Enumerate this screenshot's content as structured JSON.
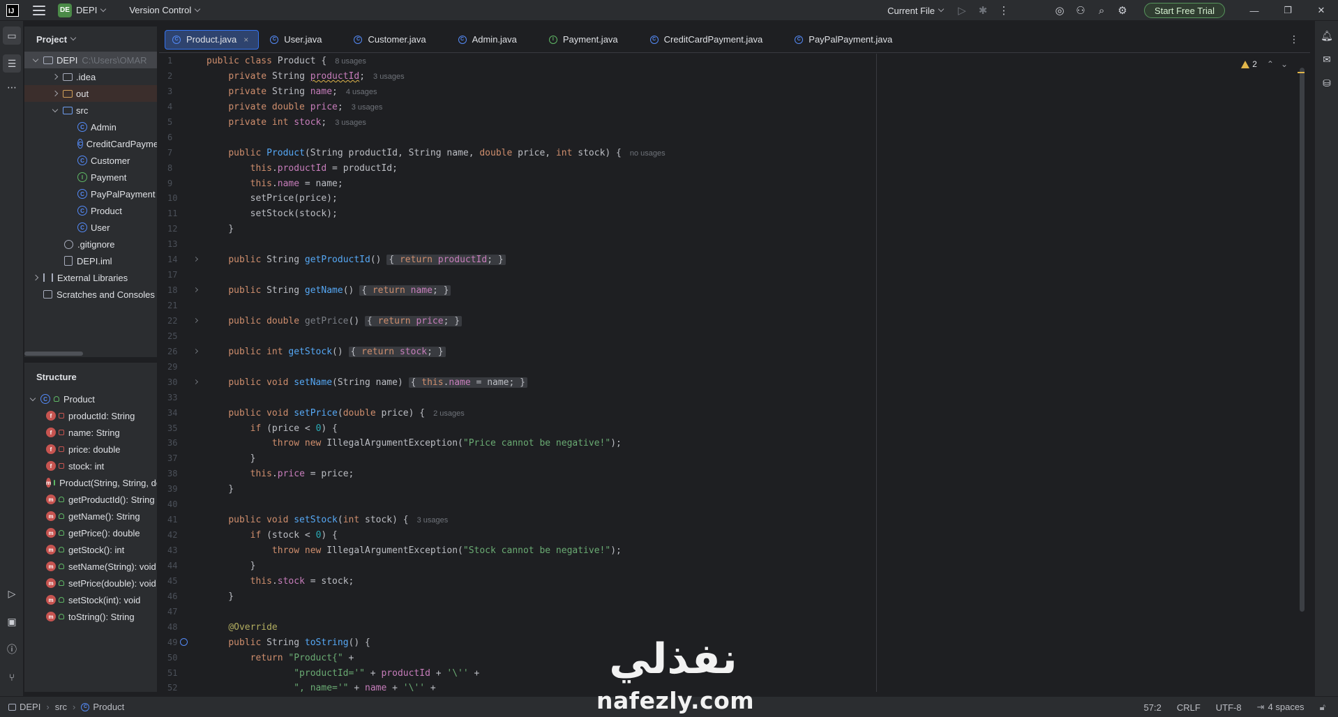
{
  "titlebar": {
    "project_badge": "DE",
    "project_name": "DEPI",
    "vcs_label": "Version Control",
    "run_config": "Current File",
    "trial_button": "Start Free Trial"
  },
  "project_panel": {
    "header": "Project",
    "items": [
      {
        "label": "DEPI",
        "path": "C:\\Users\\OMAR"
      },
      {
        "label": ".idea"
      },
      {
        "label": "out"
      },
      {
        "label": "src"
      },
      {
        "label": "Admin"
      },
      {
        "label": "CreditCardPayment"
      },
      {
        "label": "Customer"
      },
      {
        "label": "Payment"
      },
      {
        "label": "PayPalPayment"
      },
      {
        "label": "Product"
      },
      {
        "label": "User"
      },
      {
        "label": ".gitignore"
      },
      {
        "label": "DEPI.iml"
      },
      {
        "label": "External Libraries"
      },
      {
        "label": "Scratches and Consoles"
      }
    ]
  },
  "structure_panel": {
    "header": "Structure",
    "root": "Product",
    "members": [
      "productId: String",
      "name: String",
      "price: double",
      "stock: int",
      "Product(String, String, double, int)",
      "getProductId(): String",
      "getName(): String",
      "getPrice(): double",
      "getStock(): int",
      "setName(String): void",
      "setPrice(double): void",
      "setStock(int): void",
      "toString(): String"
    ]
  },
  "tabs": [
    {
      "label": "Product.java",
      "close": "×"
    },
    {
      "label": "User.java"
    },
    {
      "label": "Customer.java"
    },
    {
      "label": "Admin.java"
    },
    {
      "label": "Payment.java"
    },
    {
      "label": "CreditCardPayment.java"
    },
    {
      "label": "PayPalPayment.java"
    }
  ],
  "inspection": {
    "warnings": "2"
  },
  "hints": {
    "l1": "8 usages",
    "l2": "3 usages",
    "l3": "4 usages",
    "l4": "3 usages",
    "l5": "3 usages",
    "l7": "no usages",
    "l34": "2 usages",
    "l41": "3 usages"
  },
  "line_numbers": [
    "1",
    "2",
    "3",
    "4",
    "5",
    "6",
    "7",
    "8",
    "9",
    "10",
    "11",
    "12",
    "13",
    "14",
    "17",
    "18",
    "21",
    "22",
    "25",
    "26",
    "29",
    "30",
    "33",
    "34",
    "35",
    "36",
    "37",
    "38",
    "39",
    "40",
    "41",
    "42",
    "43",
    "44",
    "45",
    "46",
    "47",
    "48",
    "49",
    "50",
    "51",
    "52"
  ],
  "code_strings": {
    "price_msg": "\"Price cannot be negative!\"",
    "stock_msg": "\"Stock cannot be negative!\"",
    "product_open": "\"Product{\"",
    "productId_eq": "\"productId='\"",
    "quote_char": "'\\''",
    "name_eq": "\", name='\"",
    "zero": "0"
  },
  "statusbar": {
    "crumbs": [
      "DEPI",
      "src",
      "Product"
    ],
    "position": "57:2",
    "line_sep": "CRLF",
    "encoding": "UTF-8",
    "indent": "4 spaces"
  },
  "watermark": {
    "arabic": "نفذلي",
    "latin": "nafezly.com"
  },
  "colors": {
    "accent": "#3574f0",
    "trial_green": "#57965c",
    "warning": "#e0b54a"
  }
}
